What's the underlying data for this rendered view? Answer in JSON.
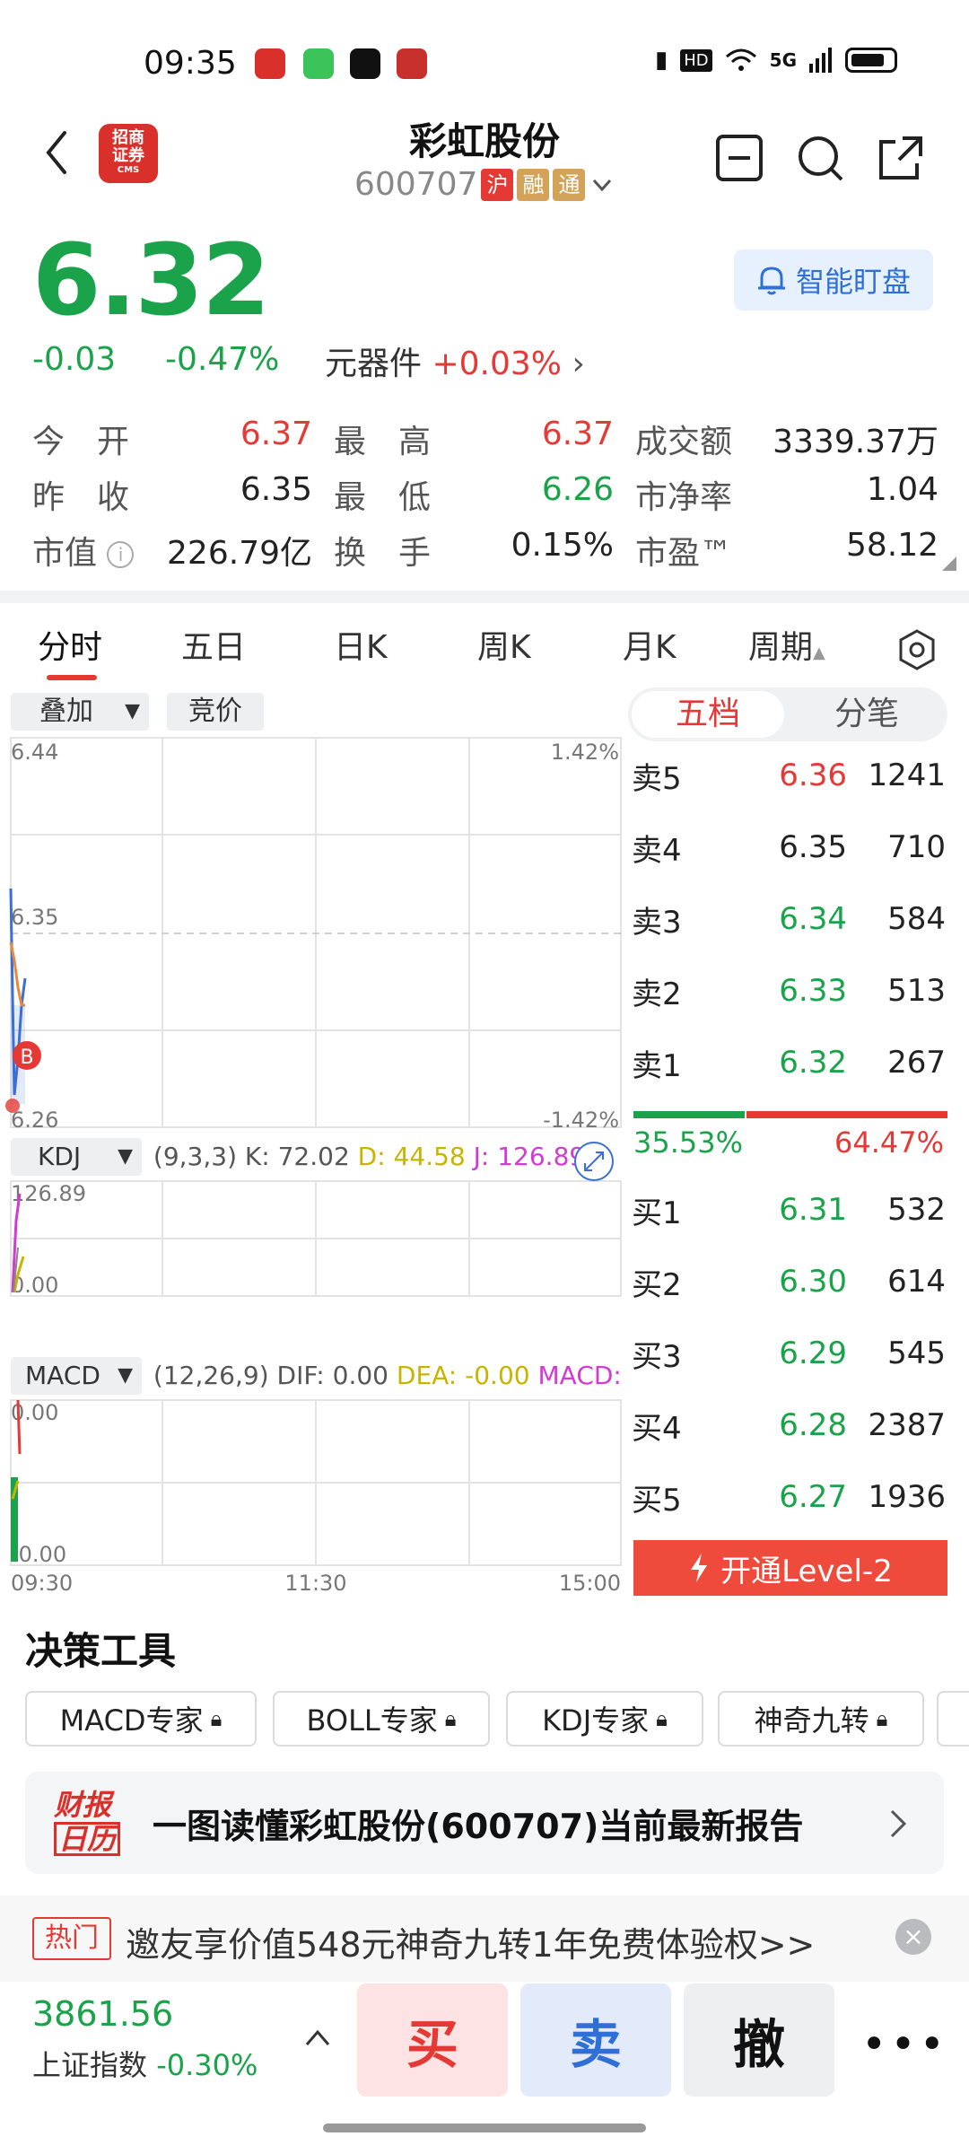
{
  "status_bar": {
    "time": "09:35",
    "network": "5G"
  },
  "header": {
    "stock_name": "彩虹股份",
    "stock_code": "600707",
    "tags": [
      "沪",
      "融",
      "通"
    ],
    "logo_text": "招商证券",
    "logo_sub": "CMS"
  },
  "quote": {
    "price": "6.32",
    "change": "-0.03",
    "change_pct": "-0.47%",
    "sector_name": "元器件",
    "sector_pct": "+0.03%",
    "monitor_label": "智能盯盘"
  },
  "stats": [
    [
      {
        "label": "今　开",
        "value": "6.37",
        "color": "red"
      },
      {
        "label": "最　高",
        "value": "6.37",
        "color": "red"
      },
      {
        "label": "成交额",
        "value": "3339.37万",
        "color": "dark"
      }
    ],
    [
      {
        "label": "昨　收",
        "value": "6.35",
        "color": "dark"
      },
      {
        "label": "最　低",
        "value": "6.26",
        "color": "green"
      },
      {
        "label": "市净率",
        "value": "1.04",
        "color": "dark"
      }
    ],
    [
      {
        "label": "市值",
        "value": "226.79亿",
        "color": "dark"
      },
      {
        "label": "换　手",
        "value": "0.15%",
        "color": "dark"
      },
      {
        "label": "市盈™",
        "value": "58.12",
        "color": "dark"
      }
    ]
  ],
  "tabs": [
    "分时",
    "五日",
    "日K",
    "周K",
    "月K",
    "周期"
  ],
  "chart_controls": {
    "overlay": "叠加",
    "bid": "竞价"
  },
  "chart_data": {
    "type": "line",
    "price_axis": {
      "top": "6.44",
      "mid": "6.35",
      "bottom": "6.26",
      "top_pct": "1.42%",
      "bottom_pct": "-1.42%"
    },
    "time_axis": [
      "09:30",
      "11:30",
      "15:00"
    ],
    "marker": "B",
    "kdj": {
      "name": "KDJ",
      "params": "(9,3,3)",
      "k": "K: 72.02",
      "d": "D: 44.58",
      "j": "J: 126.89",
      "top": "126.89",
      "bottom": "0.00"
    },
    "macd": {
      "name": "MACD",
      "params": "(12,26,9)",
      "dif": "DIF: 0.00",
      "dea": "DEA: -0.00",
      "macd": "MACD:",
      "top": "0.00",
      "bottom": "-0.00"
    }
  },
  "order_book": {
    "tabs": [
      "五档",
      "分笔"
    ],
    "asks": [
      {
        "label": "卖5",
        "price": "6.36",
        "vol": "1241",
        "color": "red"
      },
      {
        "label": "卖4",
        "price": "6.35",
        "vol": "710",
        "color": "dark"
      },
      {
        "label": "卖3",
        "price": "6.34",
        "vol": "584",
        "color": "green"
      },
      {
        "label": "卖2",
        "price": "6.33",
        "vol": "513",
        "color": "green"
      },
      {
        "label": "卖1",
        "price": "6.32",
        "vol": "267",
        "color": "green"
      }
    ],
    "ratio": {
      "buy_pct": "35.53%",
      "sell_pct": "64.47%"
    },
    "bids": [
      {
        "label": "买1",
        "price": "6.31",
        "vol": "532",
        "color": "green"
      },
      {
        "label": "买2",
        "price": "6.30",
        "vol": "614",
        "color": "green"
      },
      {
        "label": "买3",
        "price": "6.29",
        "vol": "545",
        "color": "green"
      },
      {
        "label": "买4",
        "price": "6.28",
        "vol": "2387",
        "color": "green"
      },
      {
        "label": "买5",
        "price": "6.27",
        "vol": "1936",
        "color": "green"
      }
    ],
    "level2_label": "开通Level-2"
  },
  "decision_tools": {
    "title": "决策工具",
    "items": [
      "MACD专家",
      "BOLL专家",
      "KDJ专家",
      "神奇九转"
    ]
  },
  "report": {
    "logo_line1": "财报",
    "logo_line2": "日历",
    "text": "一图读懂彩虹股份(600707)当前最新报告"
  },
  "hot": {
    "tag": "热门",
    "text": "邀友享价值548元神奇九转1年免费体验权>>"
  },
  "bottom_bar": {
    "index_value": "3861.56",
    "index_name": "上证指数",
    "index_pct": "-0.30%",
    "buy": "买",
    "sell": "卖",
    "cancel": "撤"
  }
}
